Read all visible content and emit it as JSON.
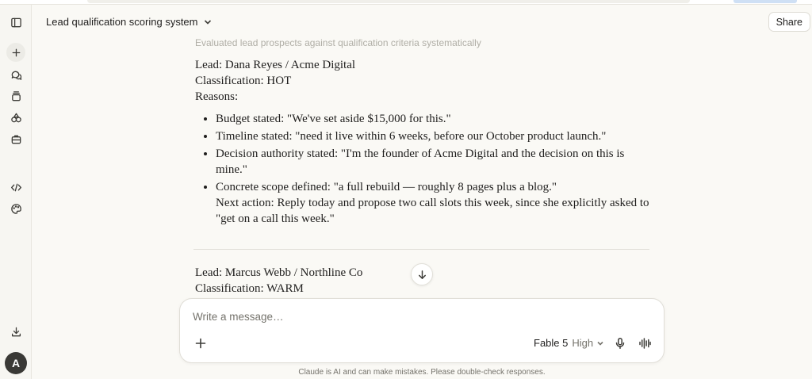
{
  "header": {
    "title": "Lead qualification scoring system",
    "share_label": "Share"
  },
  "conversation": {
    "faded_line": "Evaluated lead prospects against qualification criteria systematically",
    "lead1": {
      "lead": "Lead: Dana Reyes / Acme Digital",
      "classification": "Classification: HOT",
      "reasons_label": "Reasons:",
      "bullets": [
        "Budget stated: \"We've set aside $15,000 for this.\"",
        "Timeline stated: \"need it live within 6 weeks, before our October product launch.\"",
        "Decision authority stated: \"I'm the founder of Acme Digital and the decision on this is mine.\"",
        "Concrete scope defined: \"a full rebuild — roughly 8 pages plus a blog.\""
      ],
      "next_action": "Next action: Reply today and propose two call slots this week, since she explicitly asked to \"get on a call this week.\""
    },
    "lead2": {
      "lead": "Lead: Marcus Webb / Northline Co",
      "classification": "Classification: WARM"
    }
  },
  "composer": {
    "placeholder": "Write a message…",
    "model": "Fable 5",
    "effort": "High"
  },
  "sidebar": {
    "avatar_initial": "A",
    "icons": [
      "sidebar-toggle-icon",
      "plus-icon",
      "chats-icon",
      "projects-icon",
      "artifacts-icon",
      "briefcase-icon",
      "code-icon",
      "palette-icon",
      "download-icon"
    ]
  },
  "footer": {
    "disclaimer": "Claude is AI and can make mistakes. Please double-check responses."
  }
}
